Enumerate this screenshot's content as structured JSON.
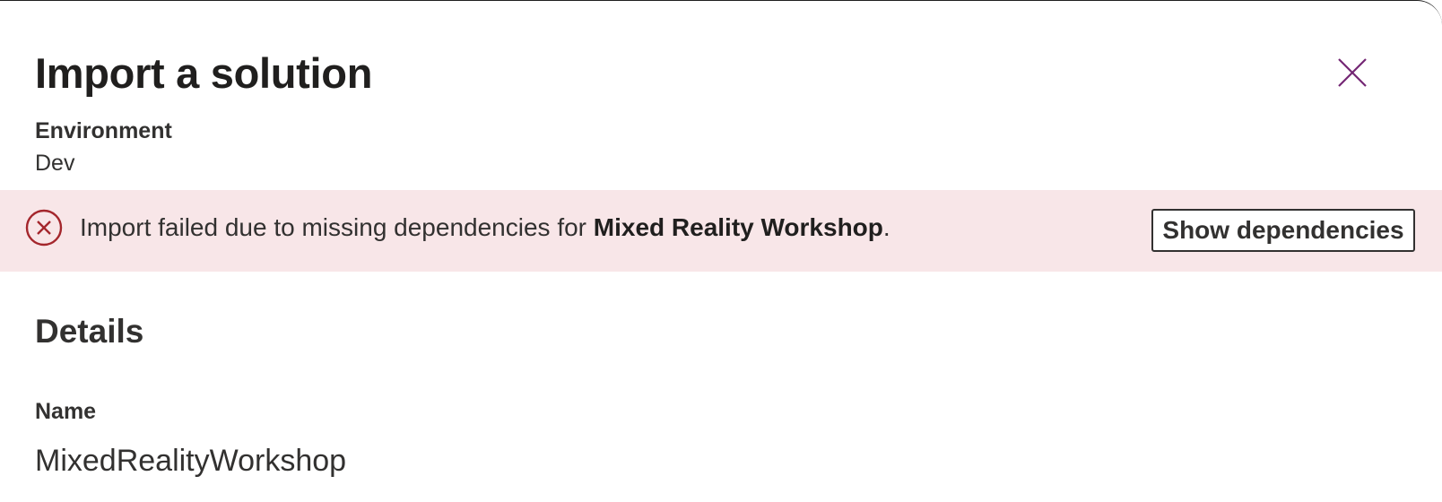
{
  "dialog": {
    "title": "Import a solution",
    "close_icon": "close-icon"
  },
  "environment": {
    "label": "Environment",
    "value": "Dev"
  },
  "error_banner": {
    "icon": "error-circle-icon",
    "message_prefix": "Import failed due to missing dependencies for ",
    "solution_name": "Mixed Reality Workshop",
    "message_suffix": ".",
    "button_label": "Show dependencies",
    "background_color": "#f8e6e8",
    "icon_color": "#a4262c"
  },
  "details": {
    "heading": "Details",
    "name_label": "Name",
    "name_value": "MixedRealityWorkshop"
  },
  "colors": {
    "accent": "#742774",
    "text": "#323130"
  }
}
